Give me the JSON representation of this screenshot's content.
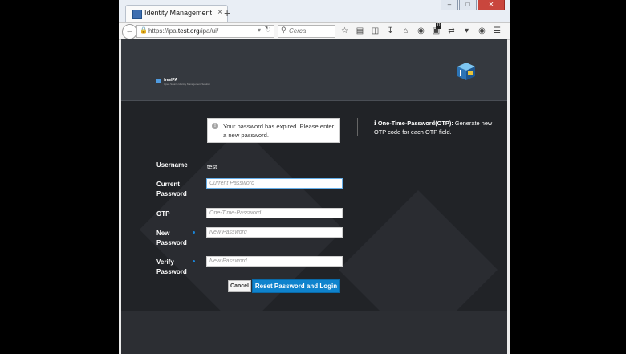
{
  "browser": {
    "tab_title": "Identity Management",
    "tab_close": "×",
    "new_tab": "+",
    "url_prefix": "https://ipa.",
    "url_host": "test.org",
    "url_path": "/ipa/ui/",
    "search_placeholder": "Cerca",
    "notification_badge": "0",
    "window_controls": [
      "–",
      "□",
      "✕"
    ]
  },
  "app": {
    "brand_title": "freeIPA",
    "brand_subtitle": "Open Source Identity Management Solution"
  },
  "alert": {
    "icon": "!",
    "text": "Your password has expired. Please enter a new password."
  },
  "otp_note": {
    "icon": "ℹ",
    "label": "One-Time-Password(OTP):",
    "text": " Generate new OTP code for each OTP field."
  },
  "form": {
    "username_label": "Username",
    "username_value": "test",
    "current_password_label": "Current Password",
    "current_password_placeholder": "Current Password",
    "otp_label": "OTP",
    "otp_placeholder": "One-Time-Password",
    "new_password_label": "New Password",
    "new_password_placeholder": "New Password",
    "verify_password_label": "Verify Password",
    "verify_password_placeholder": "New Password",
    "cancel_label": "Cancel",
    "submit_label": "Reset Password and Login"
  },
  "colors": {
    "primary": "#0f83cd",
    "required_dot": "#1a85d7",
    "page_bg": "#212327",
    "header_bg": "#35393f"
  }
}
